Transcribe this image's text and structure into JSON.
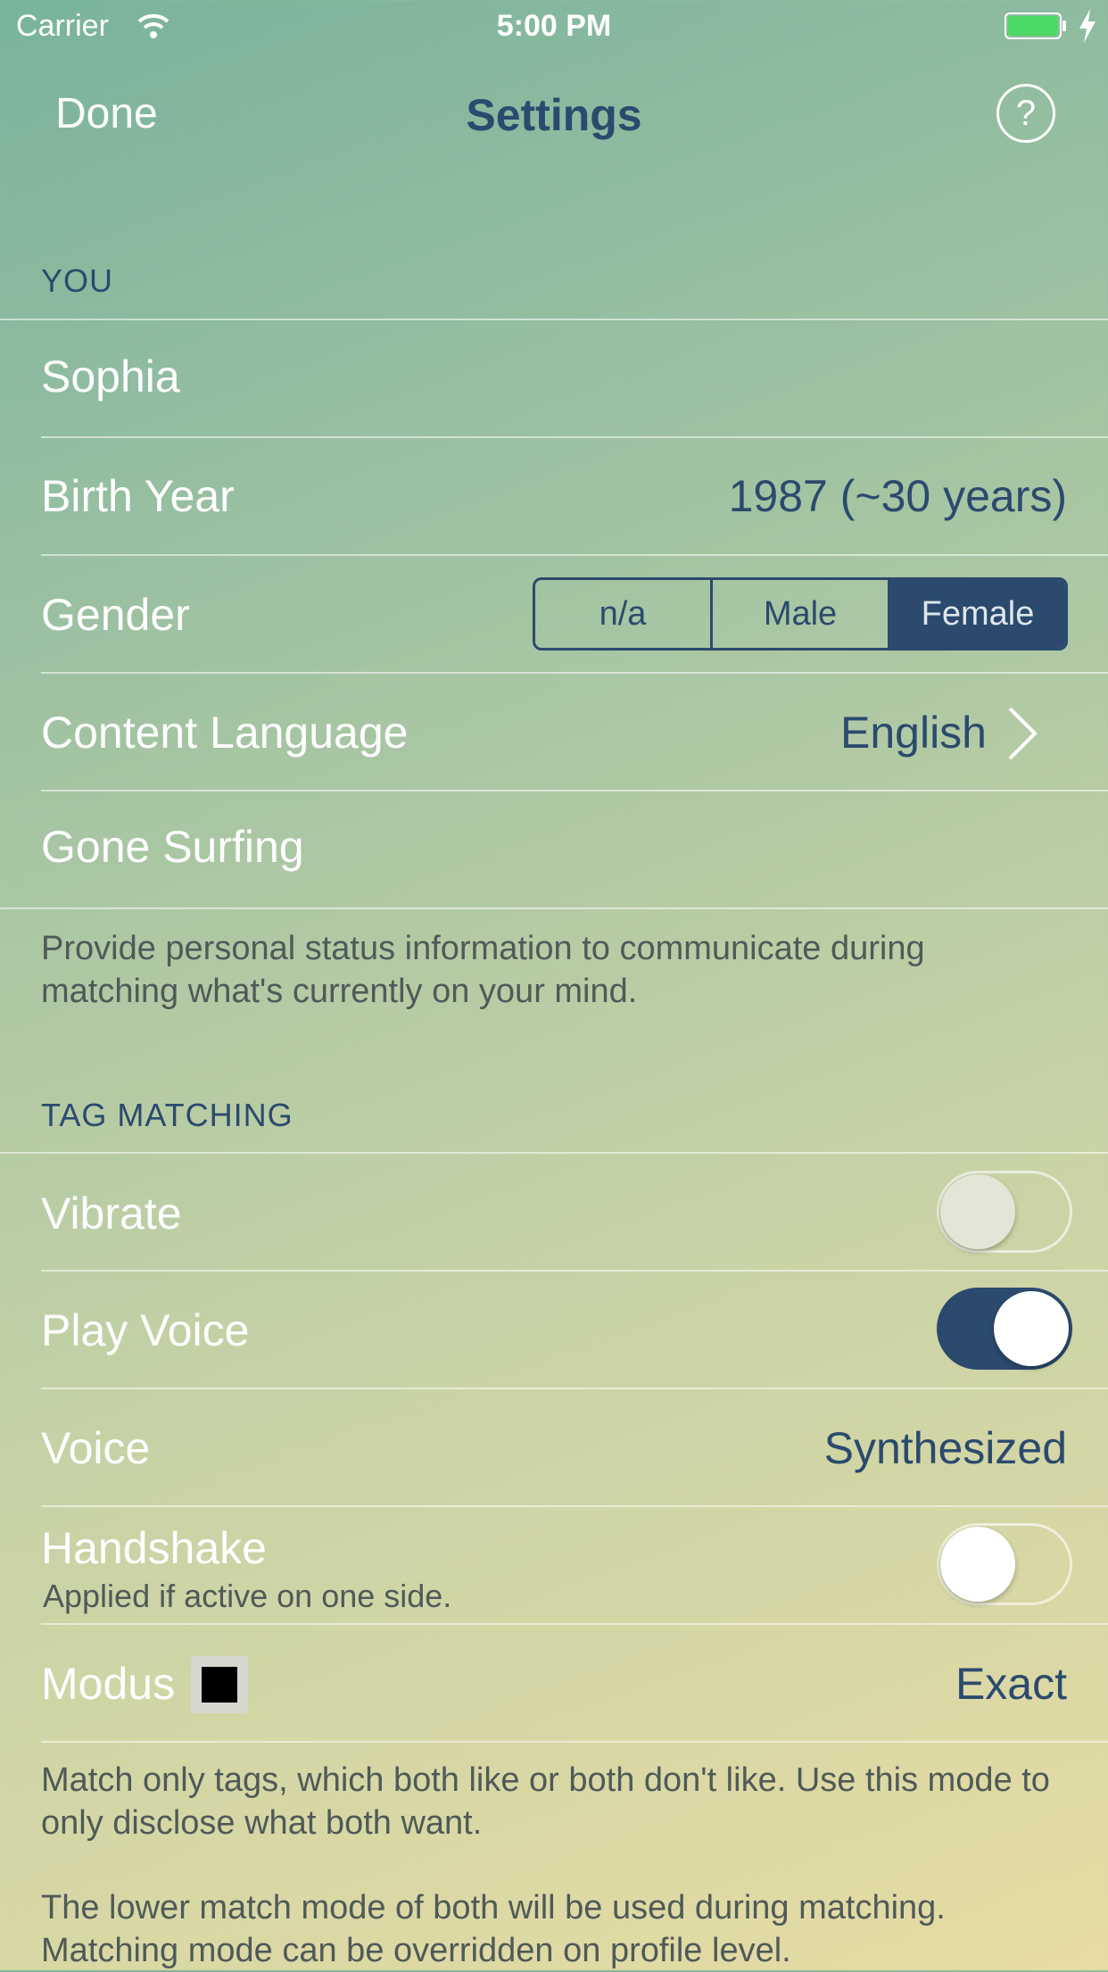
{
  "status_bar": {
    "carrier": "Carrier",
    "time": "5:00 PM",
    "battery_color": "#4cd964"
  },
  "nav": {
    "done_label": "Done",
    "title": "Settings",
    "help_label": "?"
  },
  "you_section": {
    "header": "YOU",
    "name": "Sophia",
    "birth_year_label": "Birth Year",
    "birth_year_value": "1987 (~30 years)",
    "gender_label": "Gender",
    "gender_options": [
      "n/a",
      "Male",
      "Female"
    ],
    "gender_selected": "Female",
    "content_language_label": "Content Language",
    "content_language_value": "English",
    "status_label": "Gone Surfing",
    "footer": "Provide personal status information to communicate during matching what's currently on your mind."
  },
  "tag_matching_section": {
    "header": "TAG MATCHING",
    "vibrate_label": "Vibrate",
    "vibrate_on": false,
    "play_voice_label": "Play Voice",
    "play_voice_on": true,
    "voice_label": "Voice",
    "voice_value": "Synthesized",
    "handshake_label": "Handshake",
    "handshake_sub": "Applied if active on one side.",
    "handshake_on": false,
    "modus_label": "Modus",
    "modus_value": "Exact",
    "footer_1": "Match only tags, which both like or both don't like. Use this mode to only disclose what both want.",
    "footer_2": "The lower match mode of both will be used during matching. Matching mode can be overridden on profile level."
  },
  "colors": {
    "accent": "#2b4a6e",
    "gradient_top": "#79b39c",
    "gradient_bottom": "#e7dca4"
  }
}
